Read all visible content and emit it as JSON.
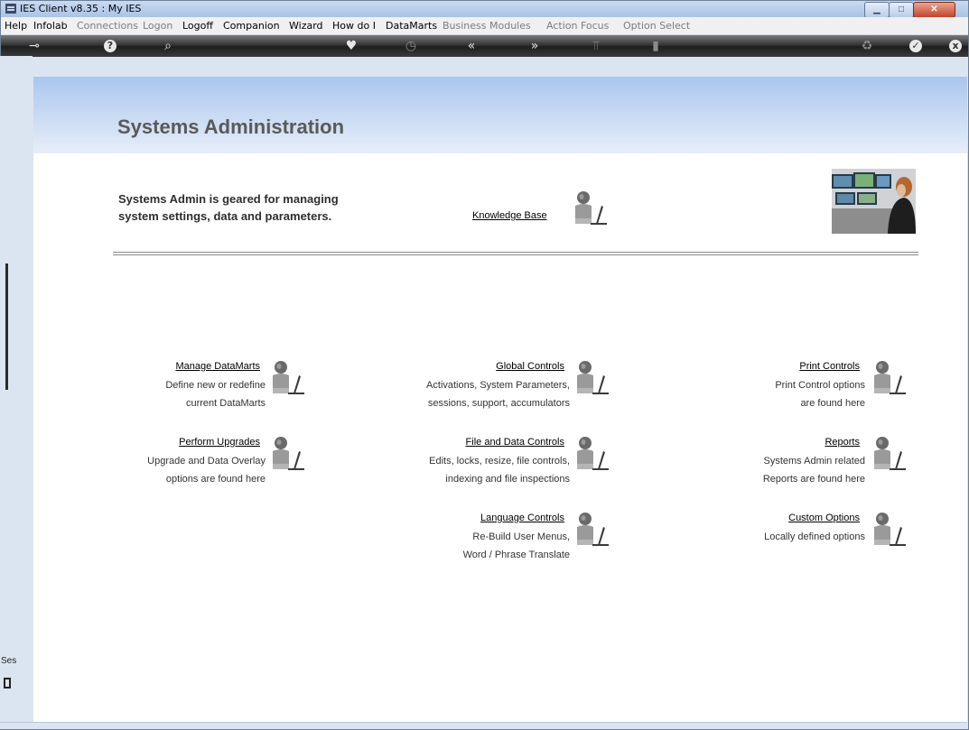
{
  "window": {
    "title": "IES Client v8.35 : My IES"
  },
  "menubar": [
    {
      "label": "Help",
      "enabled": true
    },
    {
      "label": "Infolab",
      "enabled": true
    },
    {
      "label": "Connections",
      "enabled": false
    },
    {
      "label": "Logon",
      "enabled": false
    },
    {
      "label": "Logoff",
      "enabled": true
    },
    {
      "label": "Companion",
      "enabled": true
    },
    {
      "label": "Wizard",
      "enabled": true
    },
    {
      "label": "How do I",
      "enabled": true
    },
    {
      "label": "DataMarts",
      "enabled": true
    },
    {
      "label": "Business Modules",
      "enabled": false
    },
    {
      "label": "Action Focus",
      "enabled": false
    },
    {
      "label": "Option Select",
      "enabled": false
    }
  ],
  "toolbar": {
    "icons": [
      "key-icon",
      "help-icon",
      "search-icon",
      "heart-icon",
      "clock-icon",
      "back-icon",
      "forward-icon",
      "tools-icon",
      "notes-icon",
      "recycle-icon",
      "check-icon",
      "close-icon"
    ]
  },
  "page": {
    "title": "Systems Administration",
    "intro_line1": "Systems Admin is geared for managing",
    "intro_line2": "system settings, data and parameters.",
    "knowledge_base": "Knowledge Base"
  },
  "options": {
    "manage_datamarts": {
      "title": "Manage DataMarts",
      "line1": "Define new or redefine",
      "line2": "current DataMarts"
    },
    "perform_upgrades": {
      "title": "Perform Upgrades",
      "line1": "Upgrade and Data Overlay",
      "line2": "options are found here"
    },
    "global_controls": {
      "title": "Global Controls",
      "line1": "Activations, System Parameters,",
      "line2": "sessions, support, accumulators"
    },
    "file_data_controls": {
      "title": "File and Data Controls",
      "line1": "Edits, locks, resize, file controls,",
      "line2": "indexing and file inspections"
    },
    "language_controls": {
      "title": "Language Controls",
      "line1": "Re-Build User Menus,",
      "line2": "Word / Phrase Translate"
    },
    "print_controls": {
      "title": "Print Controls",
      "line1": "Print Control options",
      "line2": "are found here"
    },
    "reports": {
      "title": "Reports",
      "line1": "Systems Admin related",
      "line2": "Reports are found here"
    },
    "custom_options": {
      "title": "Custom Options",
      "line1": "Locally defined options",
      "line2": ""
    }
  },
  "side": {
    "session_label": "Ses"
  },
  "colors": {
    "header_gradient_top": "#a9c6ee",
    "title_text": "#5a5a5a",
    "toolbar": "#2f2f2f"
  }
}
